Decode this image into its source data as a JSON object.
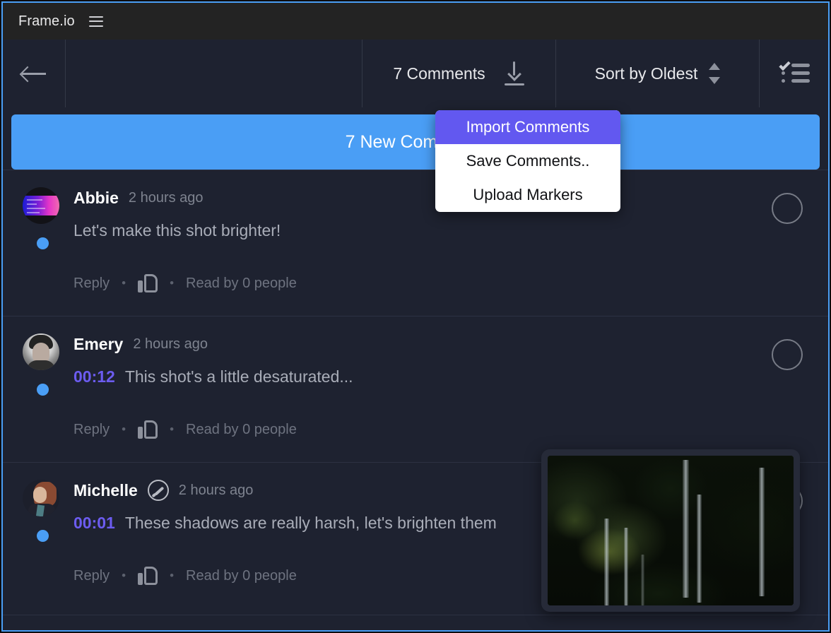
{
  "app": {
    "brand": "Frame.io",
    "menu_icon": "hamburger-icon"
  },
  "toolbar": {
    "back_icon": "arrow-left-icon",
    "comments_count_label": "7 Comments",
    "download_icon": "download-icon",
    "sort_label": "Sort by Oldest",
    "sort_spinner_icon": "chevron-up-down-icon",
    "checklist_icon": "checklist-icon"
  },
  "banner": {
    "label": "7 New Comments"
  },
  "dropdown": {
    "items": [
      {
        "label": "Import Comments",
        "active": true
      },
      {
        "label": "Save Comments..",
        "active": false
      },
      {
        "label": "Upload Markers",
        "active": false
      }
    ],
    "highlight_color": "#6258f0"
  },
  "comments": [
    {
      "author": "Abbie",
      "time": "2 hours ago",
      "timestamp": "",
      "text": "Let's make this shot brighter!",
      "reply_label": "Reply",
      "read_label": "Read by 0 people",
      "like_icon": "thumbs-up-icon",
      "unread": true,
      "badge": false,
      "avatar": "abbie-avatar"
    },
    {
      "author": "Emery",
      "time": "2 hours ago",
      "timestamp": "00:12",
      "text": "This shot's a little desaturated...",
      "reply_label": "Reply",
      "read_label": "Read by 0 people",
      "like_icon": "thumbs-up-icon",
      "unread": true,
      "badge": false,
      "avatar": "emery-avatar"
    },
    {
      "author": "Michelle",
      "time": "2 hours ago",
      "timestamp": "00:01",
      "text": "These shadows are really harsh, let's brighten them",
      "reply_label": "Reply",
      "read_label": "Read by 0 people",
      "like_icon": "thumbs-up-icon",
      "unread": true,
      "badge": true,
      "badge_icon": "annotation-brush-icon",
      "avatar": "michelle-avatar"
    }
  ],
  "thumbnail": {
    "name": "forest-frame-thumbnail"
  },
  "colors": {
    "banner_blue": "#4a9ef5",
    "timestamp_purple": "#6c5cf0",
    "window_border": "#4a9ef5",
    "titlebar_bg": "#232323",
    "panel_bg": "#1e2230"
  },
  "separators": {
    "dot": "•"
  }
}
